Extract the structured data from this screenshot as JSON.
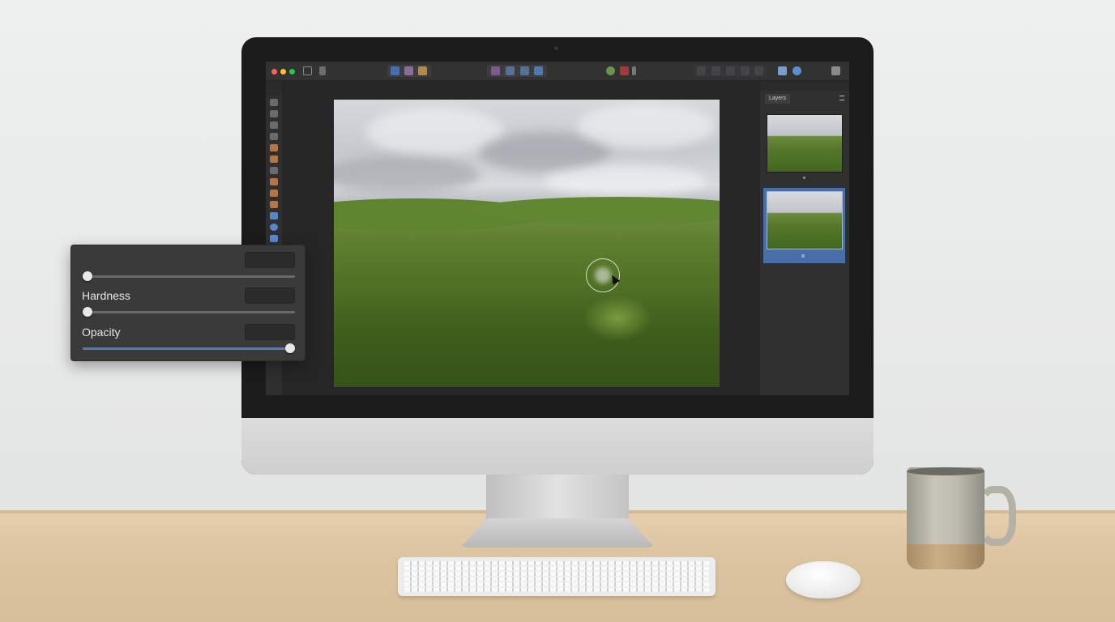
{
  "app": {
    "layers_panel": {
      "tab_label": "Layers",
      "layers": [
        {
          "name": "background-photo-copy"
        },
        {
          "name": "background-photo",
          "selected": true
        }
      ]
    }
  },
  "brush_panel": {
    "size": {
      "label": "",
      "value_field": "",
      "level": 0.0
    },
    "hardness": {
      "label": "Hardness",
      "value_field": "",
      "level": 0.0
    },
    "opacity": {
      "label": "Opacity",
      "value_field": "",
      "level": 1.0
    }
  },
  "colors": {
    "accent": "#4c7cc2",
    "selected_layer": "#4a6ea8",
    "traffic_close": "#ff5f56",
    "traffic_minimize": "#ffbd2e",
    "traffic_zoom": "#27c93f"
  },
  "icons": {
    "toolbar": [
      "sidebar-icon",
      "share-icon",
      "persona-icon",
      "liquify-icon",
      "develop-icon",
      "align-left-icon",
      "align-center-icon",
      "align-right-icon",
      "distribute-icon",
      "color-icon",
      "record-icon",
      "grid-icon",
      "snapping-icon",
      "studio-icon",
      "help-icon",
      "assistant-icon"
    ],
    "tools": [
      "move-tool-icon",
      "selection-brush-icon",
      "pen-icon",
      "lasso-icon",
      "paint-brush-icon",
      "pencil-icon",
      "eraser-icon",
      "inpaint-icon",
      "clone-icon",
      "healing-icon",
      "gradient-icon",
      "shape-icon",
      "fill-icon"
    ]
  }
}
